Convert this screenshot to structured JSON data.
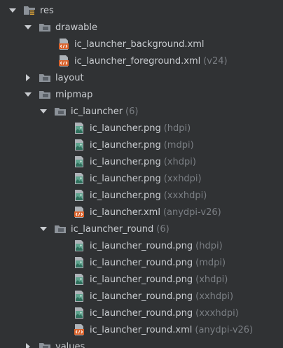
{
  "tree": [
    {
      "label": "res",
      "hint": "",
      "type": "resfolder",
      "level": 0,
      "arrow": "down"
    },
    {
      "label": "drawable",
      "hint": "",
      "type": "folder",
      "level": 1,
      "arrow": "down"
    },
    {
      "label": "ic_launcher_background.xml",
      "hint": "",
      "type": "xml",
      "level": 2,
      "arrow": "none"
    },
    {
      "label": "ic_launcher_foreground.xml",
      "hint": "(v24)",
      "type": "xml",
      "level": 2,
      "arrow": "none"
    },
    {
      "label": "layout",
      "hint": "",
      "type": "folder",
      "level": 1,
      "arrow": "right"
    },
    {
      "label": "mipmap",
      "hint": "",
      "type": "folder",
      "level": 1,
      "arrow": "down"
    },
    {
      "label": "ic_launcher",
      "hint": "(6)",
      "type": "folder",
      "level": 2,
      "arrow": "down"
    },
    {
      "label": "ic_launcher.png",
      "hint": "(hdpi)",
      "type": "png",
      "level": 3,
      "arrow": "none"
    },
    {
      "label": "ic_launcher.png",
      "hint": "(mdpi)",
      "type": "png",
      "level": 3,
      "arrow": "none"
    },
    {
      "label": "ic_launcher.png",
      "hint": "(xhdpi)",
      "type": "png",
      "level": 3,
      "arrow": "none"
    },
    {
      "label": "ic_launcher.png",
      "hint": "(xxhdpi)",
      "type": "png",
      "level": 3,
      "arrow": "none"
    },
    {
      "label": "ic_launcher.png",
      "hint": "(xxxhdpi)",
      "type": "png",
      "level": 3,
      "arrow": "none"
    },
    {
      "label": "ic_launcher.xml",
      "hint": "(anydpi-v26)",
      "type": "xml",
      "level": 3,
      "arrow": "none"
    },
    {
      "label": "ic_launcher_round",
      "hint": "(6)",
      "type": "folder",
      "level": 2,
      "arrow": "down"
    },
    {
      "label": "ic_launcher_round.png",
      "hint": "(hdpi)",
      "type": "png",
      "level": 3,
      "arrow": "none"
    },
    {
      "label": "ic_launcher_round.png",
      "hint": "(mdpi)",
      "type": "png",
      "level": 3,
      "arrow": "none"
    },
    {
      "label": "ic_launcher_round.png",
      "hint": "(xhdpi)",
      "type": "png",
      "level": 3,
      "arrow": "none"
    },
    {
      "label": "ic_launcher_round.png",
      "hint": "(xxhdpi)",
      "type": "png",
      "level": 3,
      "arrow": "none"
    },
    {
      "label": "ic_launcher_round.png",
      "hint": "(xxxhdpi)",
      "type": "png",
      "level": 3,
      "arrow": "none"
    },
    {
      "label": "ic_launcher_round.xml",
      "hint": "(anydpi-v26)",
      "type": "xml",
      "level": 3,
      "arrow": "none"
    },
    {
      "label": "values",
      "hint": "",
      "type": "folder",
      "level": 1,
      "arrow": "right"
    }
  ],
  "colors": {
    "background": "#303234",
    "text": "#c9ccd0",
    "hint": "#7b7f84",
    "folder": "#8c9299",
    "xml_icon": "#d9622b",
    "png_icon": "#5fa38e"
  },
  "icons": {
    "folder": "folder-icon",
    "resfolder": "res-folder-icon",
    "xml": "xml-file-icon",
    "png": "png-image-icon",
    "arrow_down": "chevron-down-icon",
    "arrow_right": "chevron-right-icon"
  }
}
